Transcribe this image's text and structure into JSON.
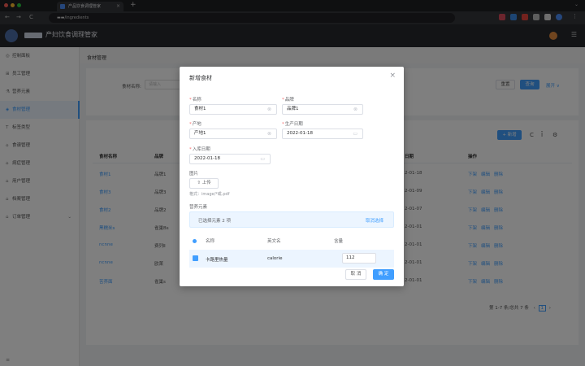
{
  "browser": {
    "tab_title": "产品饮食调理管家",
    "tab_close": "×",
    "new_tab": "+",
    "url": "▬▬/ingredients",
    "back": "←",
    "forward": "→",
    "reload": "C",
    "tab_menu": "⌄",
    "menu": "⋮"
  },
  "header": {
    "title": "产妇饮食调理管家",
    "menu_icon": "☰"
  },
  "sidebar": {
    "items": [
      {
        "icon": "◎",
        "label": "控制面板"
      },
      {
        "icon": "⊞",
        "label": "员工管理"
      },
      {
        "icon": "⚗",
        "label": "营养元素"
      },
      {
        "icon": "◈",
        "label": "食材管理"
      },
      {
        "icon": "T",
        "label": "标签类型"
      },
      {
        "icon": "⌂",
        "label": "食谱管理"
      },
      {
        "icon": "⌂",
        "label": "病症管理"
      },
      {
        "icon": "⌂",
        "label": "用户管理"
      },
      {
        "icon": "⌂",
        "label": "档案管理"
      },
      {
        "icon": "⌂",
        "label": "订单管理"
      }
    ],
    "active_index": 3,
    "order_arrow": "⌄",
    "footer": "≡"
  },
  "main": {
    "breadcrumb": "食材管理",
    "filter_label": "食材名称:",
    "filter_placeholder": "请输入",
    "reset_label": "重置",
    "search_label": "查询",
    "expand_label": "展开 ∨",
    "new_label": "+ 新增",
    "refresh_icon": "C",
    "density_icon": "Ī",
    "settings_icon": "⚙",
    "columns": [
      "食材名称",
      "品牌",
      "",
      "日期",
      "操作"
    ],
    "rows": [
      {
        "name": "食材1",
        "brand": "品牌1",
        "date": "2-01-18"
      },
      {
        "name": "食材3",
        "brand": "品牌3",
        "date": "2-01-09"
      },
      {
        "name": "食材2",
        "brand": "品牌2",
        "date": "2-01-07"
      },
      {
        "name": "黑糯米s",
        "brand": "雀巢Bs",
        "date": "2-01-01"
      },
      {
        "name": "ncnne",
        "brand": "费列Ⅱ",
        "date": "2-01-01"
      },
      {
        "name": "ncnne",
        "brand": "欧莱",
        "date": "2-01-01"
      },
      {
        "name": "苦荞面",
        "brand": "雀巢s",
        "date": "2-01-01"
      }
    ],
    "actions": [
      "下架",
      "编辑",
      "删除"
    ],
    "pagination": "第 1-7 条/总共 7 条",
    "page_prev": "‹",
    "page_num": "1",
    "page_next": "›"
  },
  "dialog": {
    "title": "新增食材",
    "close_icon": "×",
    "name_label": "名称",
    "name_value": "食材1",
    "brand_label": "品牌",
    "brand_value": "品牌1",
    "origin_label": "产地",
    "origin_value": "产地1",
    "production_date_label": "生产日期",
    "production_date_value": "2022-01-18",
    "storage_date_label": "入库日期",
    "storage_date_value": "2022-01-18",
    "image_label": "图片",
    "upload_label": "上传",
    "upload_icon": "⇧",
    "upload_hint": "格式：image/*或.pdf",
    "nutrition_label": "营养元素",
    "selected_text": "已选择元素 2 项",
    "clear_selection": "取消选择",
    "clear_icon": "⊗",
    "calendar_icon": "▭",
    "nutrition_columns": [
      "名称",
      "英文名",
      "含量"
    ],
    "nutrition_rows": [
      {
        "name": "卡路里热量",
        "english": "calorie",
        "amount": "112"
      }
    ],
    "cancel_label": "取 消",
    "confirm_label": "确 定",
    "required_mark": "*"
  }
}
